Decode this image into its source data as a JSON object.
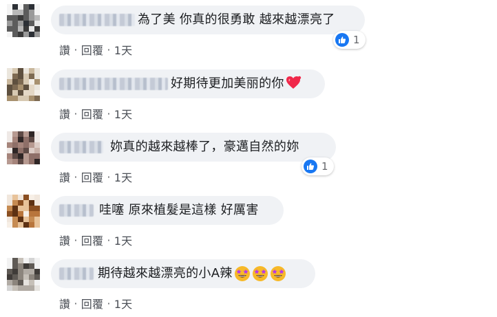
{
  "actions": {
    "like_label": "讚",
    "reply_label": "回覆",
    "separator": "·"
  },
  "comments": [
    {
      "text": "為了美 你真的很勇敢 越來越漂亮了",
      "time": "1天",
      "reaction_count": "1"
    },
    {
      "text": "好期待更加美丽的你",
      "time": "1天",
      "emoji": "heart-emoji"
    },
    {
      "text": "妳真的越來越棒了，豪邁自然的妳",
      "time": "1天",
      "reaction_count": "1"
    },
    {
      "text": "哇噻 原來植髮是這樣 好厲害",
      "time": "1天"
    },
    {
      "text": "期待越來越漂亮的小A辣",
      "time": "1天",
      "emoji": "star-struck-emoji"
    }
  ],
  "colors": {
    "bubble": "#f0f2f5",
    "like_blue": "#1877f2",
    "meta_text": "#65676b"
  }
}
